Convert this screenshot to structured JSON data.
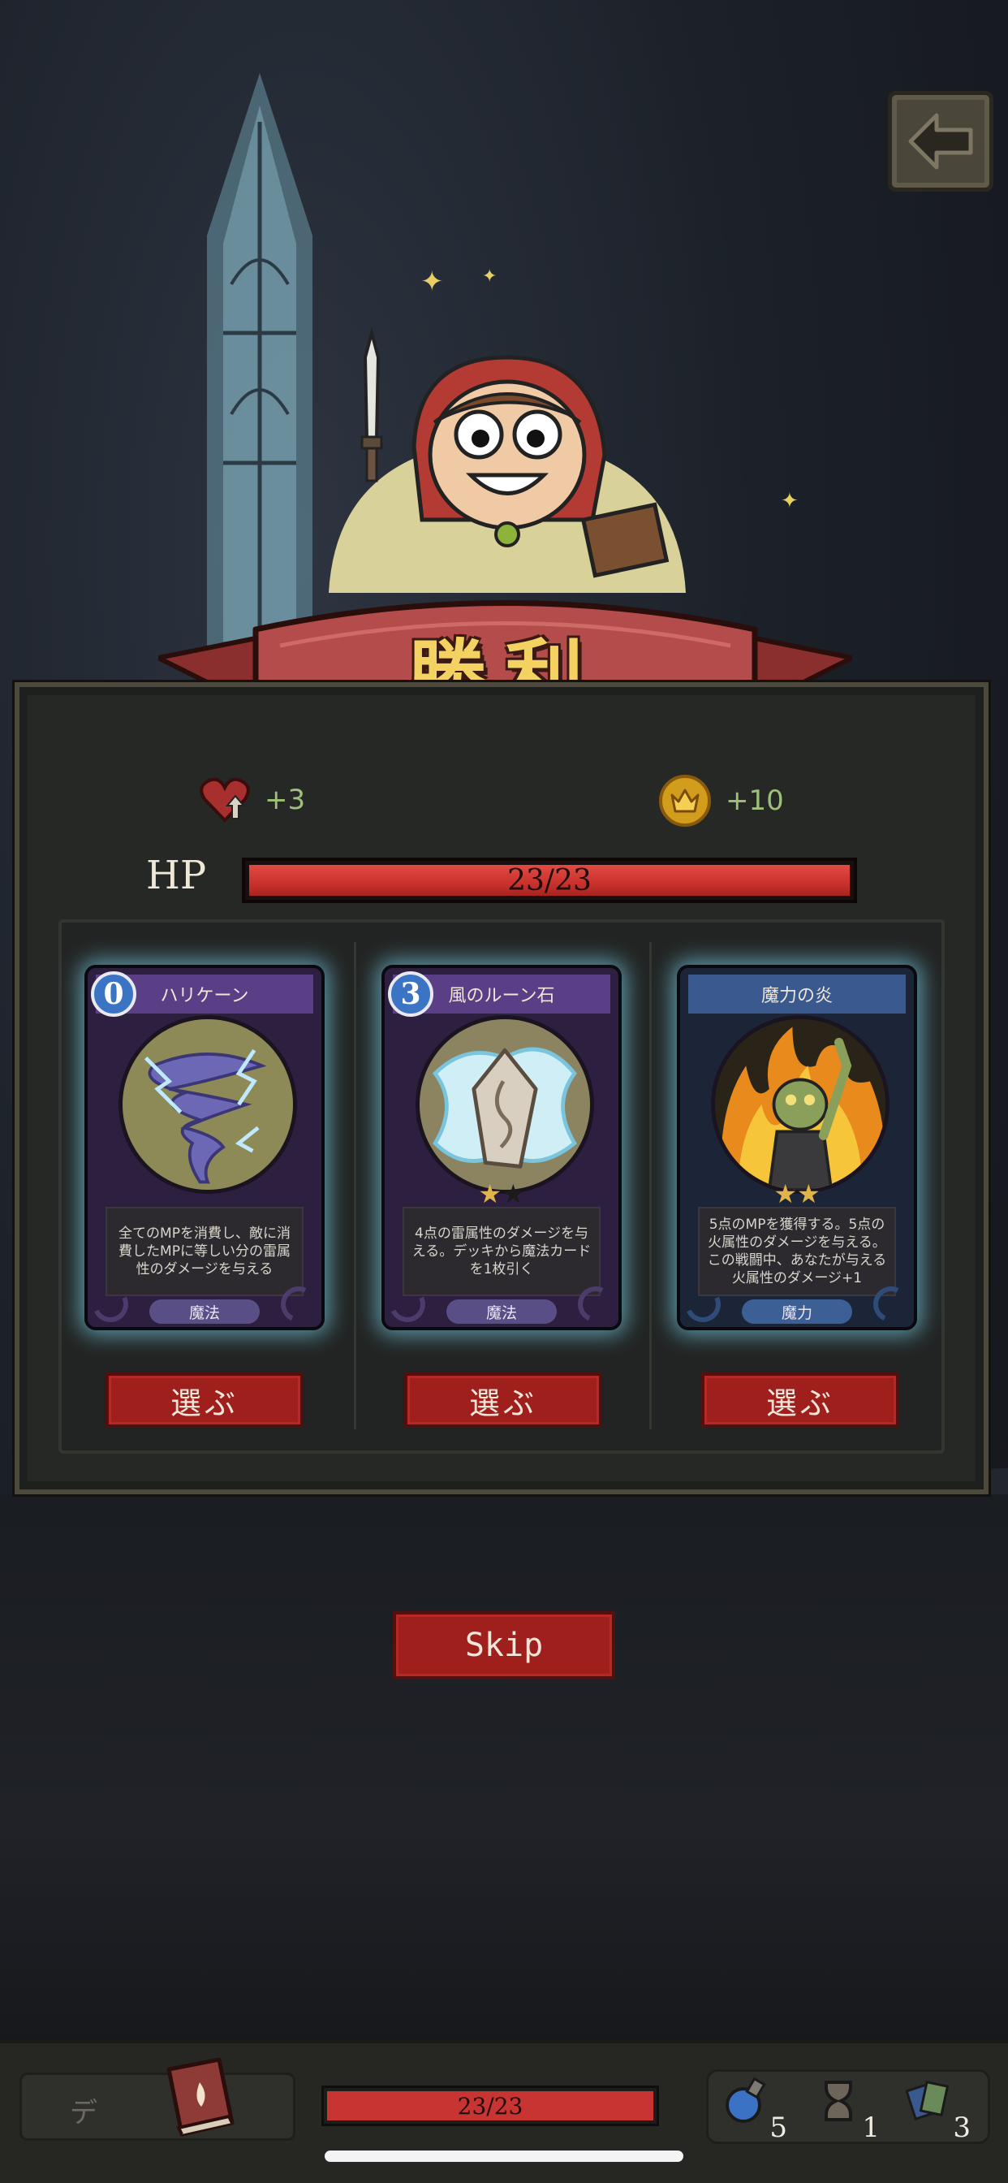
{
  "banner": {
    "title": "勝利"
  },
  "rewards": {
    "max_hp": "+3",
    "gold": "+10"
  },
  "hp": {
    "label": "HP",
    "current": 23,
    "max": 23,
    "text": "23/23"
  },
  "cards": [
    {
      "cost": "0",
      "name": "ハリケーン",
      "description": "全てのMPを消費し、敵に消費したMPに等しい分の雷属性のダメージを与える",
      "type": "魔法",
      "stars": 0,
      "frame": "purple",
      "art_icon": "tornado-icon",
      "button": "選ぶ"
    },
    {
      "cost": "3",
      "name": "風のルーン石",
      "description": "4点の雷属性のダメージを与える。デッキから魔法カードを1枚引く",
      "type": "魔法",
      "stars": 1,
      "stars_max": 2,
      "frame": "purple",
      "art_icon": "rune-stone-icon",
      "button": "選ぶ"
    },
    {
      "cost": "",
      "name": "魔力の炎",
      "description": "5点のMPを獲得する。5点の火属性のダメージを与える。この戦闘中、あなたが与える火属性のダメージ+1",
      "type": "魔力",
      "stars": 2,
      "stars_max": 2,
      "frame": "blue",
      "art_icon": "fire-zombie-icon",
      "button": "選ぶ"
    }
  ],
  "skip_button": "Skip",
  "bottom_bar": {
    "deck_label": "デ",
    "hp_text": "23/23",
    "potions": "5",
    "time": "1",
    "cards": "3"
  },
  "colors": {
    "accent_red": "#9e1f1c",
    "hp_red": "#c9322d",
    "banner_gold": "#f4d262",
    "card_glow": "#78d2eb"
  }
}
